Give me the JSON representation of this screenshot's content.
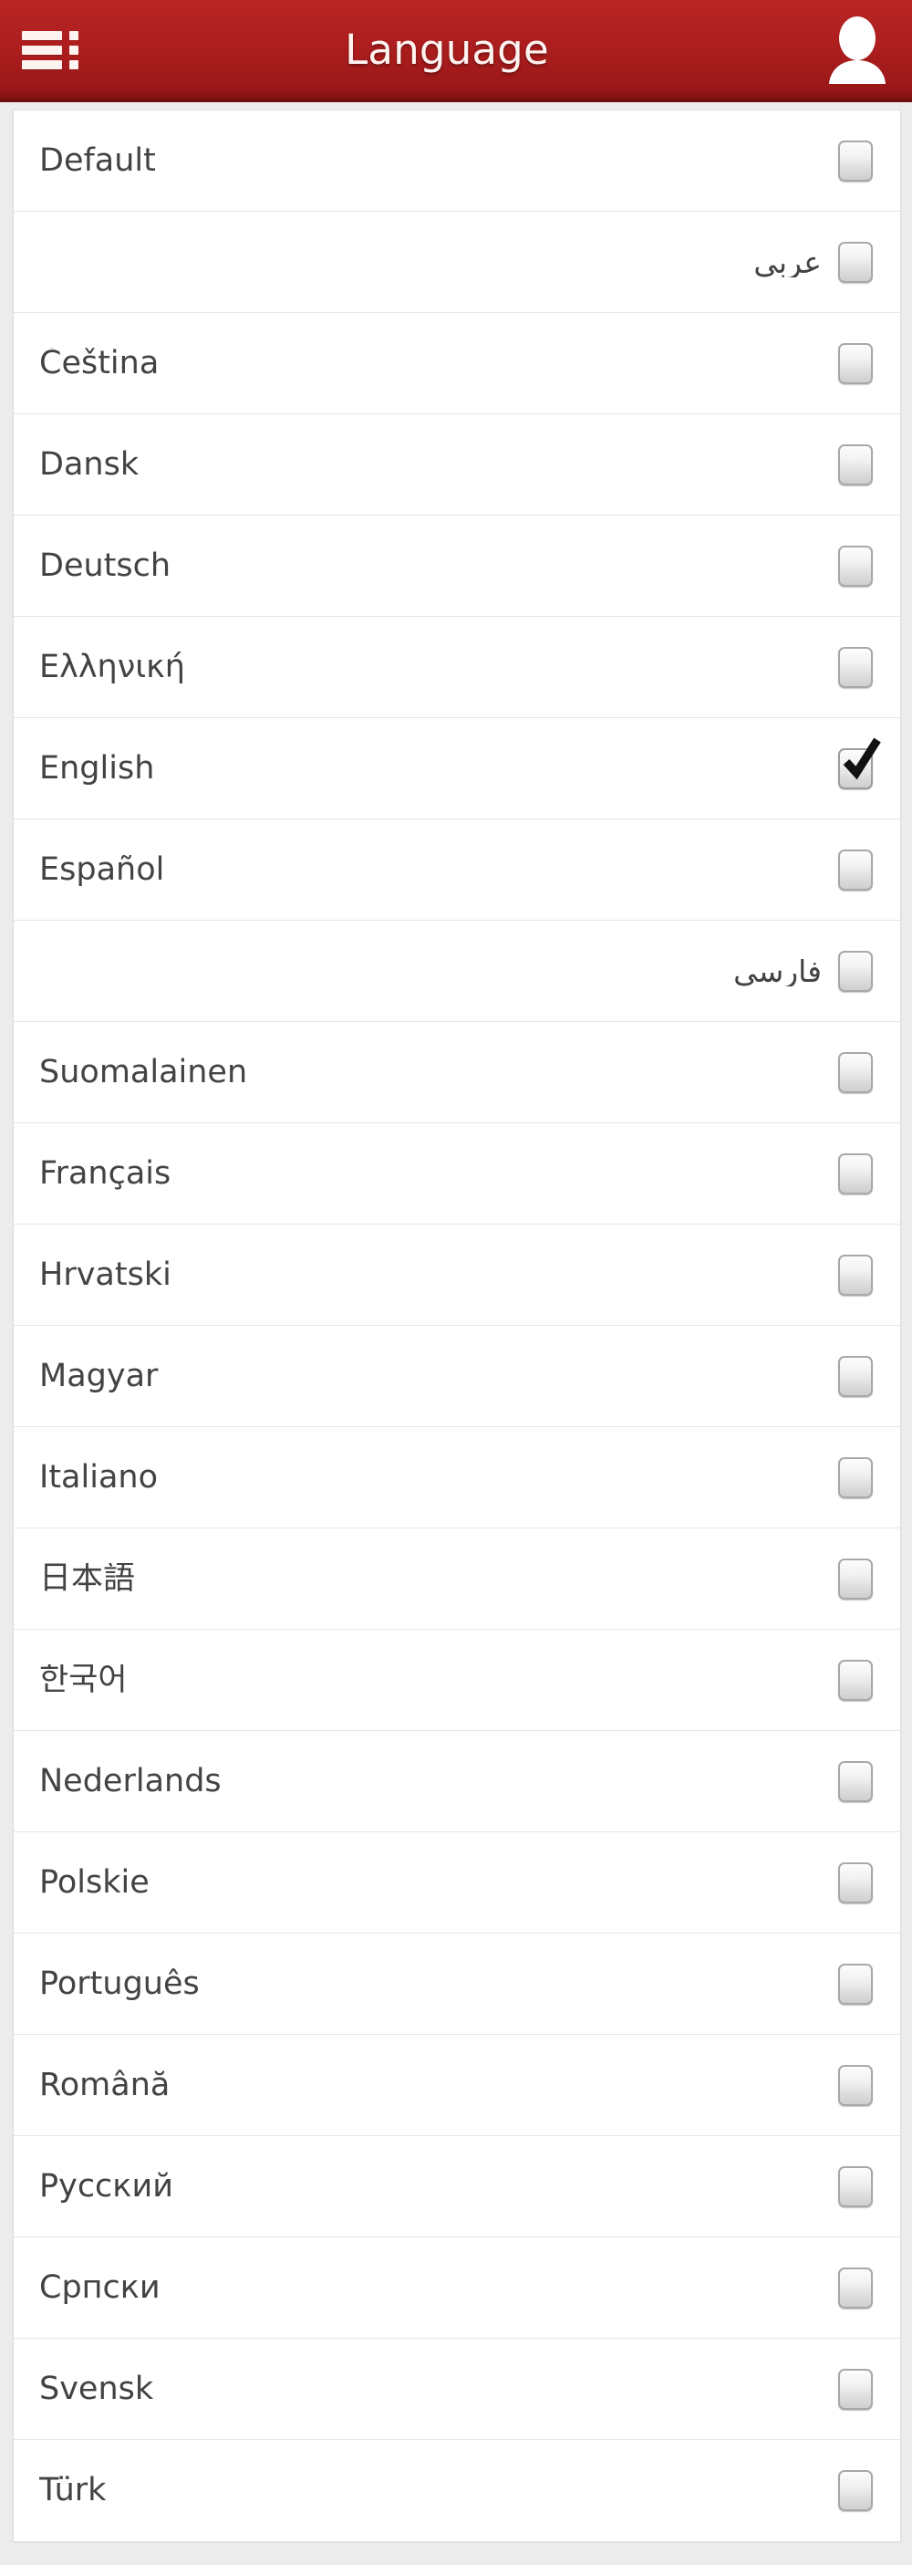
{
  "theme": {
    "header_red_top": "#b82525",
    "header_red_bottom": "#7d1111",
    "header_text": "#fdf3f1",
    "row_text": "#434343",
    "row_divider": "#e6e6e6",
    "page_background": "#ececec",
    "checkbox_border": "#a8a8a8",
    "checkmark": "#111111"
  },
  "header": {
    "title": "Language",
    "menu_icon": "list-menu-icon",
    "avatar_icon": "user-avatar-icon"
  },
  "list": {
    "selected": "English",
    "items": [
      {
        "label": "Default",
        "checked": false,
        "rtl": false
      },
      {
        "label": "عربي",
        "checked": false,
        "rtl": true
      },
      {
        "label": "Čeština",
        "checked": false,
        "rtl": false
      },
      {
        "label": "Dansk",
        "checked": false,
        "rtl": false
      },
      {
        "label": "Deutsch",
        "checked": false,
        "rtl": false
      },
      {
        "label": "Ελληνική",
        "checked": false,
        "rtl": false
      },
      {
        "label": "English",
        "checked": true,
        "rtl": false
      },
      {
        "label": "Español",
        "checked": false,
        "rtl": false
      },
      {
        "label": "فارسی",
        "checked": false,
        "rtl": true
      },
      {
        "label": "Suomalainen",
        "checked": false,
        "rtl": false
      },
      {
        "label": "Français",
        "checked": false,
        "rtl": false
      },
      {
        "label": "Hrvatski",
        "checked": false,
        "rtl": false
      },
      {
        "label": "Magyar",
        "checked": false,
        "rtl": false
      },
      {
        "label": "Italiano",
        "checked": false,
        "rtl": false
      },
      {
        "label": "日本語",
        "checked": false,
        "rtl": false
      },
      {
        "label": "한국어",
        "checked": false,
        "rtl": false
      },
      {
        "label": "Nederlands",
        "checked": false,
        "rtl": false
      },
      {
        "label": "Polskie",
        "checked": false,
        "rtl": false
      },
      {
        "label": "Português",
        "checked": false,
        "rtl": false
      },
      {
        "label": "Română",
        "checked": false,
        "rtl": false
      },
      {
        "label": "Русский",
        "checked": false,
        "rtl": false
      },
      {
        "label": "Српски",
        "checked": false,
        "rtl": false
      },
      {
        "label": "Svensk",
        "checked": false,
        "rtl": false
      },
      {
        "label": "Türk",
        "checked": false,
        "rtl": false
      }
    ]
  }
}
